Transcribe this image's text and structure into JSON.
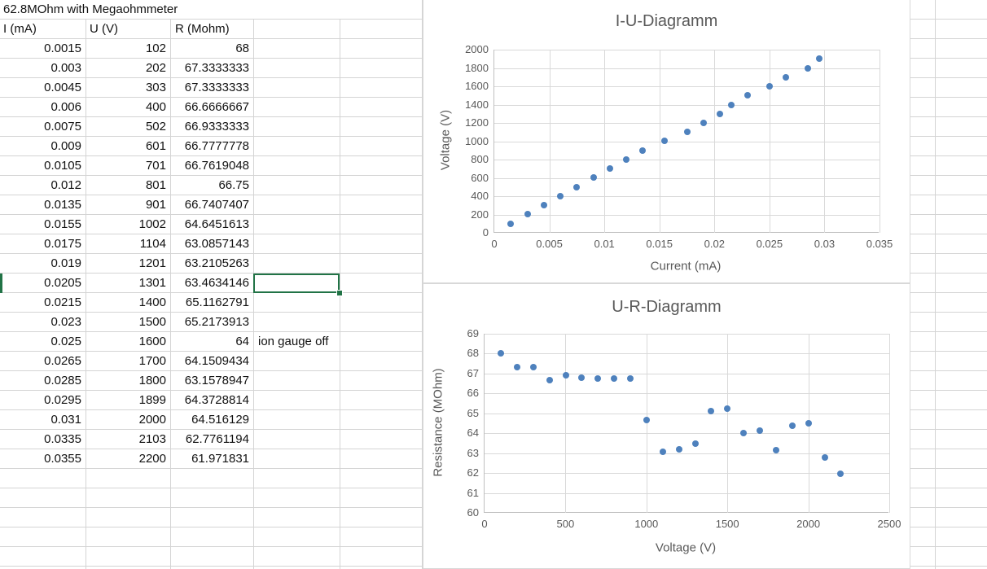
{
  "sheet": {
    "title": "62.8MOhm with Megaohmmeter",
    "headers": [
      "I (mA)",
      "U (V)",
      "R (Mohm)"
    ],
    "rows": [
      [
        "0.0015",
        "102",
        "68"
      ],
      [
        "0.003",
        "202",
        "67.3333333"
      ],
      [
        "0.0045",
        "303",
        "67.3333333"
      ],
      [
        "0.006",
        "400",
        "66.6666667"
      ],
      [
        "0.0075",
        "502",
        "66.9333333"
      ],
      [
        "0.009",
        "601",
        "66.7777778"
      ],
      [
        "0.0105",
        "701",
        "66.7619048"
      ],
      [
        "0.012",
        "801",
        "66.75"
      ],
      [
        "0.0135",
        "901",
        "66.7407407"
      ],
      [
        "0.0155",
        "1002",
        "64.6451613"
      ],
      [
        "0.0175",
        "1104",
        "63.0857143"
      ],
      [
        "0.019",
        "1201",
        "63.2105263"
      ],
      [
        "0.0205",
        "1301",
        "63.4634146"
      ],
      [
        "0.0215",
        "1400",
        "65.1162791"
      ],
      [
        "0.023",
        "1500",
        "65.2173913"
      ],
      [
        "0.025",
        "1600",
        "64"
      ],
      [
        "0.0265",
        "1700",
        "64.1509434"
      ],
      [
        "0.0285",
        "1800",
        "63.1578947"
      ],
      [
        "0.0295",
        "1899",
        "64.3728814"
      ],
      [
        "0.031",
        "2000",
        "64.516129"
      ],
      [
        "0.0335",
        "2103",
        "62.7761194"
      ],
      [
        "0.0355",
        "2200",
        "61.971831"
      ]
    ],
    "note": "ion gauge off",
    "selection_color": "#217346",
    "gridline_color": "#d4d4d4"
  },
  "chart_data": [
    {
      "type": "scatter",
      "title": "I-U-Diagramm",
      "xlabel": "Current (mA)",
      "ylabel": "Voltage (V)",
      "xlim": [
        0,
        0.035
      ],
      "ylim": [
        0,
        2000
      ],
      "xticks": [
        0,
        0.005,
        0.01,
        0.015,
        0.02,
        0.025,
        0.03,
        0.035
      ],
      "yticks": [
        0,
        200,
        400,
        600,
        800,
        1000,
        1200,
        1400,
        1600,
        1800,
        2000
      ],
      "grid": true,
      "legend": "none",
      "marker_color": "#4e81bd",
      "x": [
        0.0015,
        0.003,
        0.0045,
        0.006,
        0.0075,
        0.009,
        0.0105,
        0.012,
        0.0135,
        0.0155,
        0.0175,
        0.019,
        0.0205,
        0.0215,
        0.023,
        0.025,
        0.0265,
        0.0285,
        0.0295
      ],
      "y": [
        102,
        202,
        303,
        400,
        502,
        601,
        701,
        801,
        901,
        1002,
        1104,
        1201,
        1301,
        1400,
        1500,
        1600,
        1700,
        1800,
        1899
      ]
    },
    {
      "type": "scatter",
      "title": "U-R-Diagramm",
      "xlabel": "Voltage (V)",
      "ylabel": "Resistance (MOhm)",
      "xlim": [
        0,
        2500
      ],
      "ylim": [
        60,
        69
      ],
      "xticks": [
        0,
        500,
        1000,
        1500,
        2000,
        2500
      ],
      "yticks": [
        60,
        61,
        62,
        63,
        64,
        65,
        66,
        67,
        68,
        69
      ],
      "grid": true,
      "legend": "none",
      "marker_color": "#4e81bd",
      "x": [
        102,
        202,
        303,
        400,
        502,
        601,
        701,
        801,
        901,
        1002,
        1104,
        1201,
        1301,
        1400,
        1500,
        1600,
        1700,
        1800,
        1899,
        2000,
        2103,
        2200
      ],
      "y": [
        68,
        67.3333333,
        67.3333333,
        66.6666667,
        66.9333333,
        66.7777778,
        66.7619048,
        66.75,
        66.7407407,
        64.6451613,
        63.0857143,
        63.2105263,
        63.4634146,
        65.1162791,
        65.2173913,
        64,
        64.1509434,
        63.1578947,
        64.3728814,
        64.516129,
        62.7761194,
        61.971831
      ]
    }
  ]
}
